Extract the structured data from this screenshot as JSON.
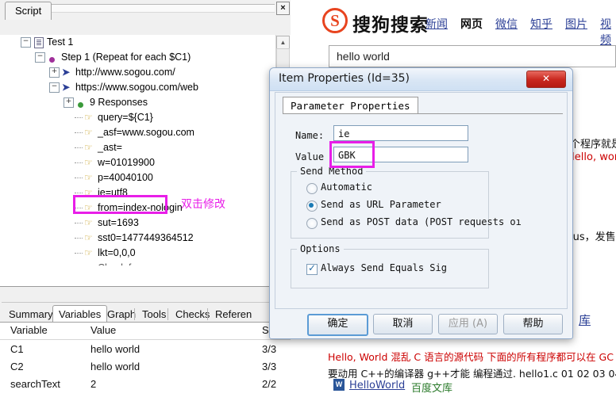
{
  "left_pane": {
    "close_button": "×",
    "tab_label": "Script",
    "tree": [
      {
        "indent": 26,
        "expander": "−",
        "icon": "document-icon",
        "label": "Test 1"
      },
      {
        "indent": 44,
        "expander": "−",
        "icon": "step-dot-icon",
        "label": "Step 1 (Repeat for each $C1)"
      },
      {
        "indent": 62,
        "expander": "+",
        "icon": "request-arrow-icon",
        "label": "http://www.sogou.com/"
      },
      {
        "indent": 62,
        "expander": "−",
        "icon": "request-arrow-icon",
        "label": "https://www.sogou.com/web"
      },
      {
        "indent": 80,
        "expander": "+",
        "icon": "response-dot-icon",
        "label": "9 Responses"
      },
      {
        "indent": 94,
        "expander": "",
        "icon": "parameter-key-icon",
        "label": "query=${C1}"
      },
      {
        "indent": 94,
        "expander": "",
        "icon": "parameter-key-icon",
        "label": "_asf=www.sogou.com"
      },
      {
        "indent": 94,
        "expander": "",
        "icon": "parameter-key-icon",
        "label": "_ast="
      },
      {
        "indent": 94,
        "expander": "",
        "icon": "parameter-key-icon",
        "label": "w=01019900"
      },
      {
        "indent": 94,
        "expander": "",
        "icon": "parameter-key-icon",
        "label": "p=40040100"
      },
      {
        "indent": 94,
        "expander": "",
        "icon": "parameter-key-icon",
        "label": "ie=utf8"
      },
      {
        "indent": 94,
        "expander": "",
        "icon": "parameter-key-icon",
        "label": "from=index-nologin"
      },
      {
        "indent": 94,
        "expander": "",
        "icon": "parameter-key-icon",
        "label": "sut=1693"
      },
      {
        "indent": 94,
        "expander": "",
        "icon": "parameter-key-icon",
        "label": "sst0=1477449364512"
      },
      {
        "indent": 94,
        "expander": "",
        "icon": "parameter-key-icon",
        "label": "lkt=0,0,0"
      }
    ],
    "annotation": {
      "text": "双击修改",
      "color": "#e81ee8"
    },
    "bottom_tabs": [
      {
        "label": "Summary",
        "selected": false
      },
      {
        "label": "Variables",
        "selected": true
      },
      {
        "label": "Graph",
        "selected": false
      },
      {
        "label": "Tools",
        "selected": false
      },
      {
        "label": "Checks",
        "selected": false
      },
      {
        "label": "Referen",
        "selected": false
      }
    ],
    "table": {
      "columns": [
        "Variable",
        "Value",
        "Se"
      ],
      "rows": [
        [
          "C1",
          "hello world",
          "3/3"
        ],
        [
          "C2",
          "hello world",
          "3/3"
        ],
        [
          "searchText",
          "2",
          "2/2"
        ]
      ]
    }
  },
  "browser": {
    "logo_letter": "S",
    "site_name": "搜狗搜索",
    "nav": [
      {
        "label": "新闻",
        "current": false
      },
      {
        "label": "网页",
        "current": true
      },
      {
        "label": "微信",
        "current": false
      },
      {
        "label": "知乎",
        "current": false
      },
      {
        "label": "图片",
        "current": false
      },
      {
        "label": "视频",
        "current": false
      }
    ],
    "search_value": "hello world",
    "search_placeholder": "",
    "snippets": [
      {
        "text": "个程序就是",
        "color": "black"
      },
      {
        "text": "Hello, wor",
        "color": "red"
      },
      {
        "text": "lus，发售",
        "color": "black"
      },
      {
        "text": "库",
        "color": "blue"
      }
    ],
    "result_line1": "Hello, World 混乱 C 语言的源代码 下面的所有程序都可以在 GC",
    "result_line2": "要动用 C++的编译器 g++才能 编程通过. hello1.c 01 02 03 04 0",
    "result_doc_icon": "W",
    "result_doc_link": "HelloWorld",
    "result_doc_source": "百度文库"
  },
  "dialog": {
    "title": "Item Properties (Id=35)",
    "close_label": "✕",
    "tab_label": "Parameter Properties",
    "fields": [
      {
        "label": "Name:",
        "value": "ie"
      },
      {
        "label": "Value",
        "value": "GBK"
      }
    ],
    "send_method": {
      "legend": "Send Method",
      "options": [
        {
          "label": "Automatic",
          "selected": false
        },
        {
          "label": "Send as URL Parameter",
          "selected": true
        },
        {
          "label": "Send as POST data (POST requests oı",
          "selected": false
        }
      ]
    },
    "options_group": {
      "legend": "Options",
      "checkboxes": [
        {
          "label": "Always Send Equals Sig",
          "checked": true
        }
      ]
    },
    "buttons": [
      {
        "label": "确定",
        "default": true,
        "disabled": false
      },
      {
        "label": "取消",
        "default": false,
        "disabled": false
      },
      {
        "label": "应用 (A)",
        "default": false,
        "disabled": true
      },
      {
        "label": "帮助",
        "default": false,
        "disabled": false
      }
    ]
  }
}
